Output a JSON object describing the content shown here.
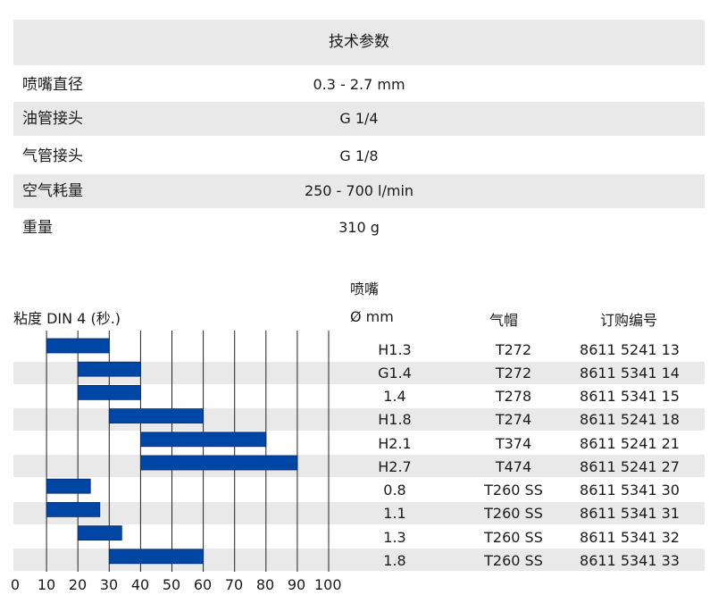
{
  "spec": {
    "title": "技术参数",
    "rows": [
      {
        "label": "喷嘴直径",
        "value": "0.3 - 2.7 mm"
      },
      {
        "label": "油管接头",
        "value": "G 1/4"
      },
      {
        "label": "气管接头",
        "value": "G 1/8"
      },
      {
        "label": "空气耗量",
        "value": "250 - 700 l/min"
      },
      {
        "label": "重量",
        "value": "310 g"
      }
    ]
  },
  "table": {
    "viscosity_label": "粘度 DIN 4 (秒.)",
    "nozzle_label": "喷嘴",
    "diameter_label": "Ø mm",
    "aircap_label": "气帽",
    "order_label": "订购编号",
    "rows": [
      {
        "nozzle": "H1.3",
        "aircap": "T272",
        "order_no": "8611 5241 13"
      },
      {
        "nozzle": "G1.4",
        "aircap": "T272",
        "order_no": "8611 5341 14"
      },
      {
        "nozzle": "1.4",
        "aircap": "T278",
        "order_no": "8611 5341 15"
      },
      {
        "nozzle": "H1.8",
        "aircap": "T274",
        "order_no": "8611 5241 18"
      },
      {
        "nozzle": "H2.1",
        "aircap": "T374",
        "order_no": "8611 5241 21"
      },
      {
        "nozzle": "H2.7",
        "aircap": "T474",
        "order_no": "8611 5241 27"
      },
      {
        "nozzle": "0.8",
        "aircap": "T260 SS",
        "order_no": "8611 5341 30"
      },
      {
        "nozzle": "1.1",
        "aircap": "T260 SS",
        "order_no": "8611 5341 31"
      },
      {
        "nozzle": "1.3",
        "aircap": "T260 SS",
        "order_no": "8611 5341 32"
      },
      {
        "nozzle": "1.8",
        "aircap": "T260 SS",
        "order_no": "8611 5341 33"
      }
    ]
  },
  "chart_data": {
    "type": "bar",
    "orientation": "horizontal",
    "x_ticks": [
      "0",
      "10",
      "20",
      "30",
      "40",
      "50",
      "60",
      "70",
      "80",
      "90",
      "100"
    ],
    "xlim": [
      0,
      100
    ],
    "grid": true,
    "bar_color": "#0047a5",
    "ranges": [
      {
        "row": "H1.3",
        "start": 10,
        "end": 30
      },
      {
        "row": "G1.4",
        "start": 20,
        "end": 40
      },
      {
        "row": "1.4",
        "start": 20,
        "end": 40
      },
      {
        "row": "H1.8",
        "start": 30,
        "end": 60
      },
      {
        "row": "H2.1",
        "start": 40,
        "end": 80
      },
      {
        "row": "H2.7",
        "start": 40,
        "end": 90
      },
      {
        "row": "0.8",
        "start": 10,
        "end": 24
      },
      {
        "row": "1.1",
        "start": 10,
        "end": 27
      },
      {
        "row": "1.3",
        "start": 20,
        "end": 34
      },
      {
        "row": "1.8",
        "start": 30,
        "end": 60
      }
    ]
  }
}
